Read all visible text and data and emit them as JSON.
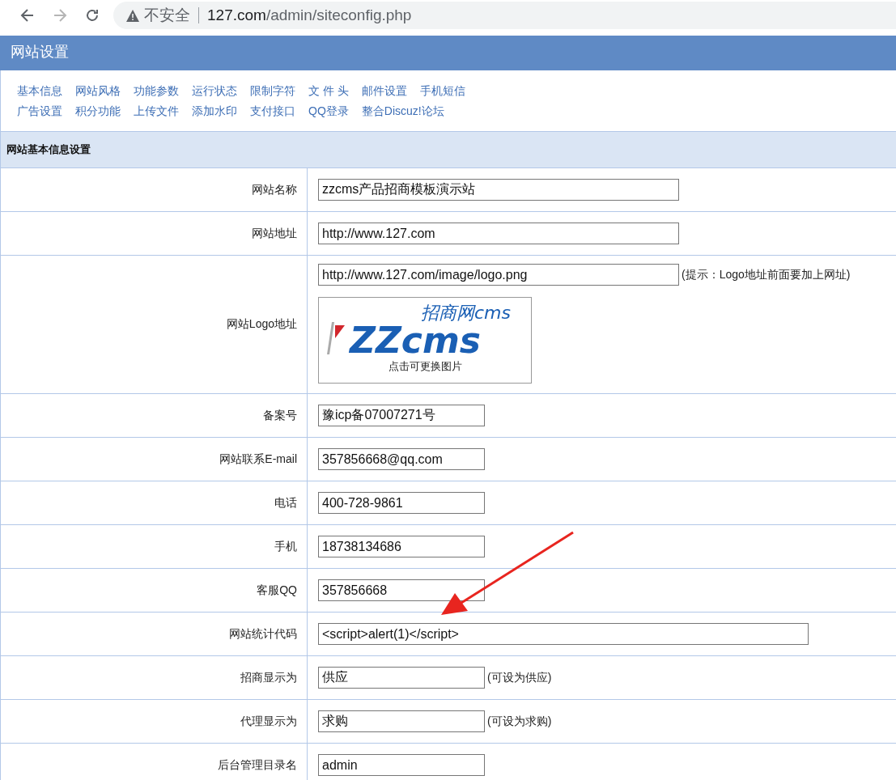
{
  "browser": {
    "back": {
      "disabled": false
    },
    "forward": {
      "disabled": true
    },
    "security": "不安全",
    "url_host": "127.com",
    "url_path": "/admin/siteconfig.php"
  },
  "header": {
    "title": "网站设置"
  },
  "nav": {
    "rows": [
      [
        "基本信息",
        "网站风格",
        "功能参数",
        "运行状态",
        "限制字符",
        "文 件 头",
        "邮件设置",
        "手机短信"
      ],
      [
        "广告设置",
        "积分功能",
        "上传文件",
        "添加水印",
        "支付接口",
        "QQ登录",
        "整合Discuz!论坛"
      ]
    ]
  },
  "section": {
    "title": "网站基本信息设置"
  },
  "rows": [
    {
      "kind": "medium",
      "label": "网站名称",
      "value": "zzcms产品招商模板演示站"
    },
    {
      "kind": "medium",
      "label": "网站地址",
      "value": "http://www.127.com"
    },
    {
      "kind": "logo",
      "label": "网站Logo地址",
      "value": "http://www.127.com/image/logo.png",
      "hint": "(提示：Logo地址前面要加上网址)",
      "logo": {
        "tagline": "招商网cms",
        "wordmark": "ZZcms",
        "caption": "点击可更换图片"
      }
    },
    {
      "kind": "short",
      "label": "备案号",
      "value": "豫icp备07007271号"
    },
    {
      "kind": "short",
      "label": "网站联系E-mail",
      "value": "357856668@qq.com"
    },
    {
      "kind": "short",
      "label": "电话",
      "value": "400-728-9861"
    },
    {
      "kind": "short",
      "label": "手机",
      "value": "18738134686"
    },
    {
      "kind": "short",
      "label": "客服QQ",
      "value": "357856668"
    },
    {
      "kind": "long",
      "label": "网站统计代码",
      "value": "<script>alert(1)</script>"
    },
    {
      "kind": "short",
      "label": "招商显示为",
      "value": "供应",
      "hint": "(可设为供应)"
    },
    {
      "kind": "short",
      "label": "代理显示为",
      "value": "求购",
      "hint": "(可设为求购)"
    },
    {
      "kind": "short",
      "label": "后台管理目录名",
      "value": "admin"
    }
  ],
  "annotation": {
    "kind": "arrow"
  }
}
